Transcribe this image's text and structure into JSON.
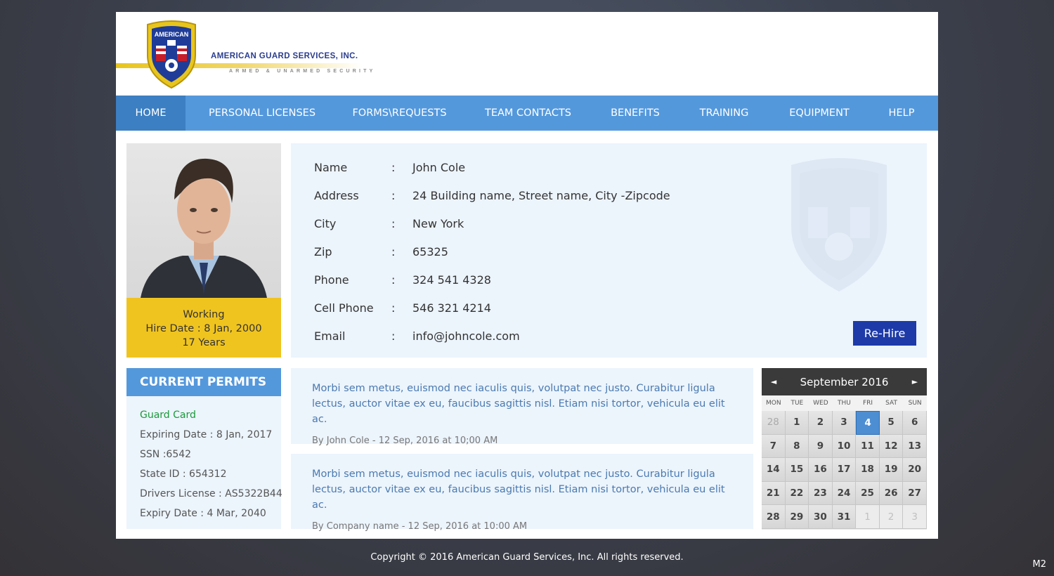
{
  "logo": {
    "shield_text": "AMERICAN",
    "company_name": "AMERICAN GUARD SERVICES, INC.",
    "tagline": "ARMED & UNARMED SECURITY"
  },
  "nav": {
    "items": [
      "HOME",
      "PERSONAL LICENSES",
      "FORMS\\REQUESTS",
      "TEAM CONTACTS",
      "BENEFITS",
      "TRAINING",
      "EQUIPMENT",
      "HELP"
    ],
    "active": "HOME"
  },
  "profile": {
    "status": "Working",
    "hire_date": "Hire Date : 8 Jan, 2000",
    "tenure": "17 Years",
    "fields": [
      {
        "label": "Name",
        "value": "John Cole"
      },
      {
        "label": "Address",
        "value": "24 Building name, Street name, City -Zipcode"
      },
      {
        "label": "City",
        "value": "New York"
      },
      {
        "label": "Zip",
        "value": "65325"
      },
      {
        "label": "Phone",
        "value": "324 541 4328"
      },
      {
        "label": "Cell Phone",
        "value": "546 321 4214"
      },
      {
        "label": "Email",
        "value": "info@johncole.com"
      }
    ],
    "colon": ":",
    "rehire_label": "Re-Hire"
  },
  "permits": {
    "title": "CURRENT PERMITS",
    "lines": [
      "Guard Card",
      "Expiring Date : 8 Jan, 2017",
      "SSN :6542",
      "State ID : 654312",
      "Drivers License : AS5322B44",
      "Expiry Date : 4 Mar, 2040"
    ]
  },
  "posts": [
    {
      "text": "Morbi sem metus, euismod nec iaculis quis, volutpat nec justo. Curabitur ligula lectus, auctor vitae ex eu, faucibus sagittis nisl. Etiam nisi tortor, vehicula eu elit ac.",
      "meta": "By John Cole - 12 Sep, 2016  at  10;00 AM"
    },
    {
      "text": "Morbi sem metus, euismod nec iaculis quis, volutpat nec justo. Curabitur ligula lectus, auctor vitae ex eu, faucibus sagittis nisl. Etiam nisi tortor, vehicula eu elit ac.",
      "meta": "By Company name - 12 Sep, 2016  at  10:00 AM"
    }
  ],
  "calendar": {
    "title": "September 2016",
    "prev": "◄",
    "next": "►",
    "days_of_week": [
      "MON",
      "TUE",
      "WED",
      "THU",
      "FRI",
      "SAT",
      "SUN"
    ],
    "days": [
      {
        "d": "28",
        "kind": "muted"
      },
      {
        "d": "1"
      },
      {
        "d": "2"
      },
      {
        "d": "3"
      },
      {
        "d": "4",
        "kind": "today"
      },
      {
        "d": "5"
      },
      {
        "d": "6"
      },
      {
        "d": "7"
      },
      {
        "d": "8"
      },
      {
        "d": "9"
      },
      {
        "d": "10"
      },
      {
        "d": "11"
      },
      {
        "d": "12"
      },
      {
        "d": "13"
      },
      {
        "d": "14"
      },
      {
        "d": "15"
      },
      {
        "d": "16"
      },
      {
        "d": "17"
      },
      {
        "d": "18"
      },
      {
        "d": "19"
      },
      {
        "d": "20"
      },
      {
        "d": "21"
      },
      {
        "d": "22"
      },
      {
        "d": "23"
      },
      {
        "d": "24"
      },
      {
        "d": "25"
      },
      {
        "d": "26"
      },
      {
        "d": "27"
      },
      {
        "d": "28"
      },
      {
        "d": "29"
      },
      {
        "d": "30"
      },
      {
        "d": "31"
      },
      {
        "d": "1",
        "kind": "dim"
      },
      {
        "d": "2",
        "kind": "dim"
      },
      {
        "d": "3",
        "kind": "dim"
      }
    ]
  },
  "footer": {
    "copyright": "Copyright  ©  2016  American Guard Services, Inc.   All rights reserved."
  },
  "corner_badge": "M2",
  "colors": {
    "nav": "#5498dc",
    "nav_active": "#3c7fc2",
    "status_yellow": "#f0c41f",
    "panel": "#ecf4fc",
    "button": "#1d3aa8",
    "link_green": "#1a9a3a",
    "calendar_today": "#4d8ed3"
  }
}
